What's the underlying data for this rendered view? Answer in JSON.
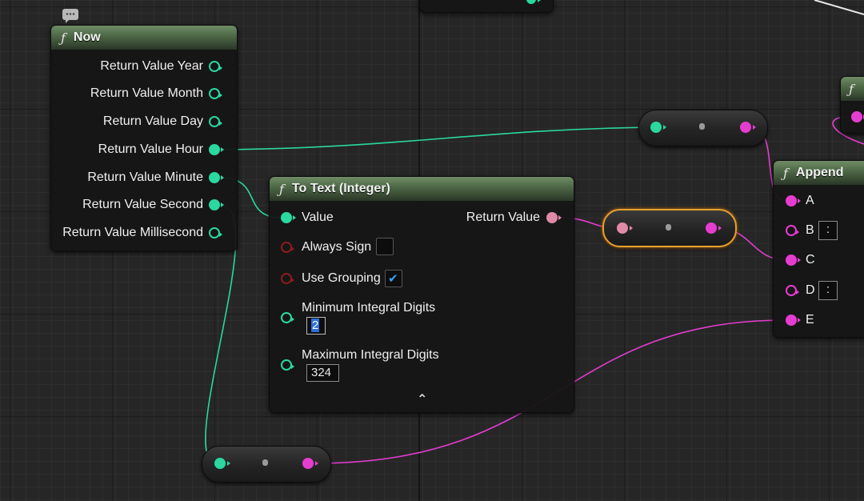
{
  "nodes": {
    "now": {
      "title": "Now",
      "function_icon": "ƒ",
      "outputs": [
        "Return Value Year",
        "Return Value Month",
        "Return Value Day",
        "Return Value Hour",
        "Return Value Minute",
        "Return Value Second",
        "Return Value Millisecond"
      ]
    },
    "to_text": {
      "title": "To Text (Integer)",
      "function_icon": "ƒ",
      "input_value": "Value",
      "output_return": "Return Value",
      "always_sign": {
        "label": "Always Sign",
        "checked": false
      },
      "use_grouping": {
        "label": "Use Grouping",
        "checked": true
      },
      "min_digits": {
        "label": "Minimum Integral Digits",
        "value": "2"
      },
      "max_digits": {
        "label": "Maximum Integral Digits",
        "value": "324"
      },
      "collapse_glyph": "^"
    },
    "append": {
      "title": "Append",
      "function_icon": "ƒ",
      "inputs": [
        "A",
        "B",
        "C",
        "D",
        "E"
      ],
      "b_value": ":",
      "d_value": ":"
    },
    "partial": {
      "function_icon": "ƒ"
    }
  },
  "colors": {
    "integer_wire": "#2ad8a0",
    "text_wire": "#e53dd0",
    "selection": "#e8a030",
    "node_header": "#4c6645"
  },
  "icons": [
    "comment-icon",
    "function-icon",
    "checkmark-icon",
    "collapse-arrow-icon"
  ]
}
